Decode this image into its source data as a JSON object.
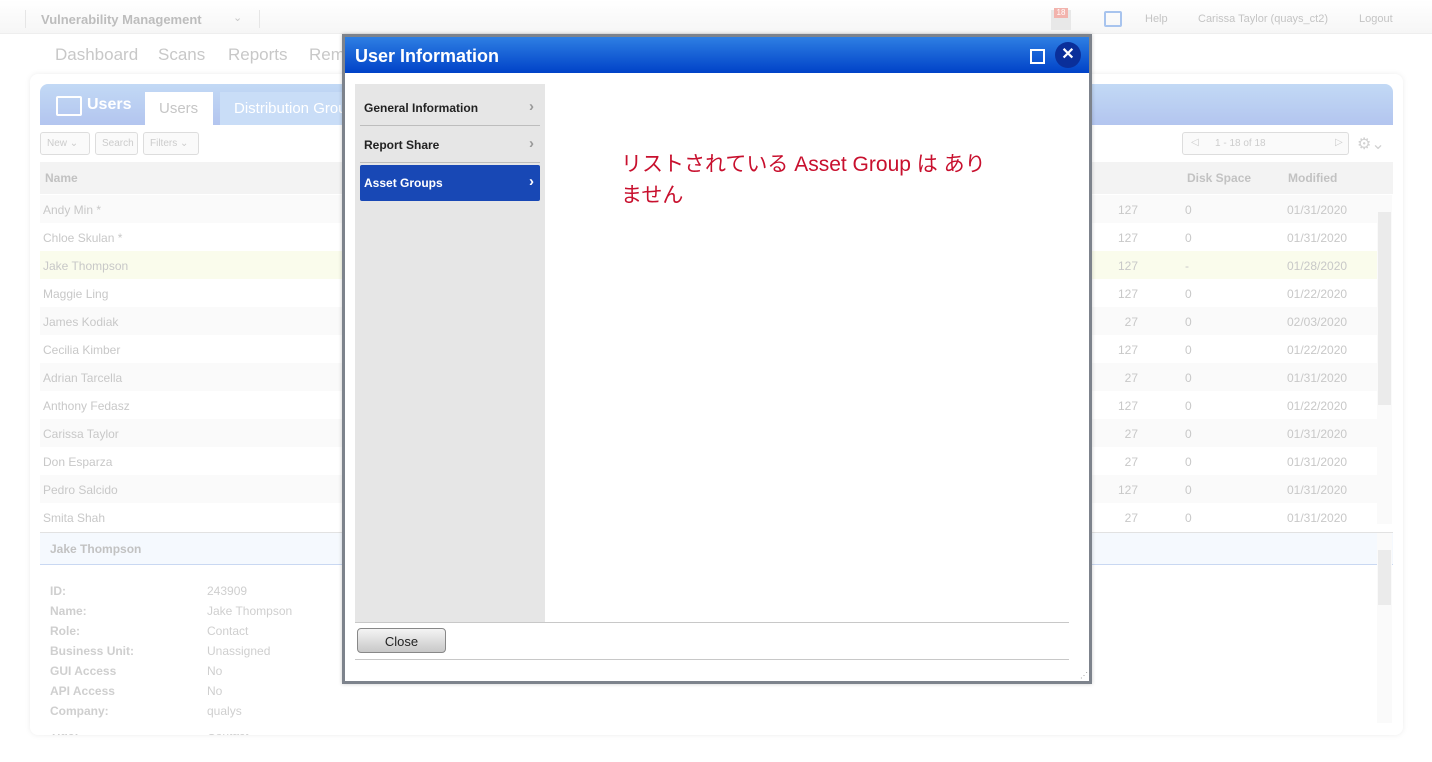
{
  "topbar": {
    "app_title": "Vulnerability Management",
    "notifications_count": "18",
    "help": "Help",
    "user": "Carissa Taylor (quays_ct2)",
    "logout": "Logout"
  },
  "nav": [
    "Dashboard",
    "Scans",
    "Reports",
    "Rem"
  ],
  "users_panel": {
    "title": "Users",
    "tabs": [
      "Users",
      "Distribution Grou"
    ],
    "toolbar": {
      "new": "New",
      "search": "Search",
      "filters": "Filters",
      "pagination": "1 - 18 of 18"
    },
    "columns": {
      "name": "Name",
      "disk_space": "Disk Space",
      "modified": "Modified"
    },
    "rows": [
      {
        "name": "Andy Min *",
        "partial": "127",
        "disk": "0",
        "modified": "01/31/2020"
      },
      {
        "name": "Chloe Skulan *",
        "partial": "127",
        "disk": "0",
        "modified": "01/31/2020"
      },
      {
        "name": "Jake Thompson",
        "partial": "127",
        "disk": "-",
        "modified": "01/28/2020"
      },
      {
        "name": "Maggie Ling",
        "partial": "127",
        "disk": "0",
        "modified": "01/22/2020"
      },
      {
        "name": "James Kodiak",
        "partial": "27",
        "disk": "0",
        "modified": "02/03/2020"
      },
      {
        "name": "Cecilia Kimber",
        "partial": "127",
        "disk": "0",
        "modified": "01/22/2020"
      },
      {
        "name": "Adrian Tarcella",
        "partial": "27",
        "disk": "0",
        "modified": "01/31/2020"
      },
      {
        "name": "Anthony Fedasz",
        "partial": "127",
        "disk": "0",
        "modified": "01/22/2020"
      },
      {
        "name": "Carissa Taylor",
        "partial": "27",
        "disk": "0",
        "modified": "01/31/2020"
      },
      {
        "name": "Don Esparza",
        "partial": "27",
        "disk": "0",
        "modified": "01/31/2020"
      },
      {
        "name": "Pedro Salcido",
        "partial": "127",
        "disk": "0",
        "modified": "01/31/2020"
      },
      {
        "name": "Smita Shah",
        "partial": "27",
        "disk": "0",
        "modified": "01/31/2020"
      }
    ]
  },
  "details": {
    "title": "Jake Thompson",
    "fields": [
      {
        "label": "ID:",
        "value": "243909"
      },
      {
        "label": "Name:",
        "value": "Jake Thompson"
      },
      {
        "label": "Role:",
        "value": "Contact"
      },
      {
        "label": "Business Unit:",
        "value": "Unassigned"
      },
      {
        "label": "GUI Access",
        "value": "No"
      },
      {
        "label": "API Access",
        "value": "No"
      },
      {
        "label": "Company:",
        "value": "qualys"
      },
      {
        "label": "Title:",
        "value": "Contact"
      }
    ]
  },
  "modal": {
    "title": "User Information",
    "menu": [
      "General Information",
      "Report Share",
      "Asset Groups"
    ],
    "active_index": 2,
    "message": "リストされている Asset Group は ありません",
    "close": "Close",
    "colors": {
      "title_bar": "#0a4fd0",
      "active_item": "#1848b5",
      "message": "#c8102e"
    }
  }
}
